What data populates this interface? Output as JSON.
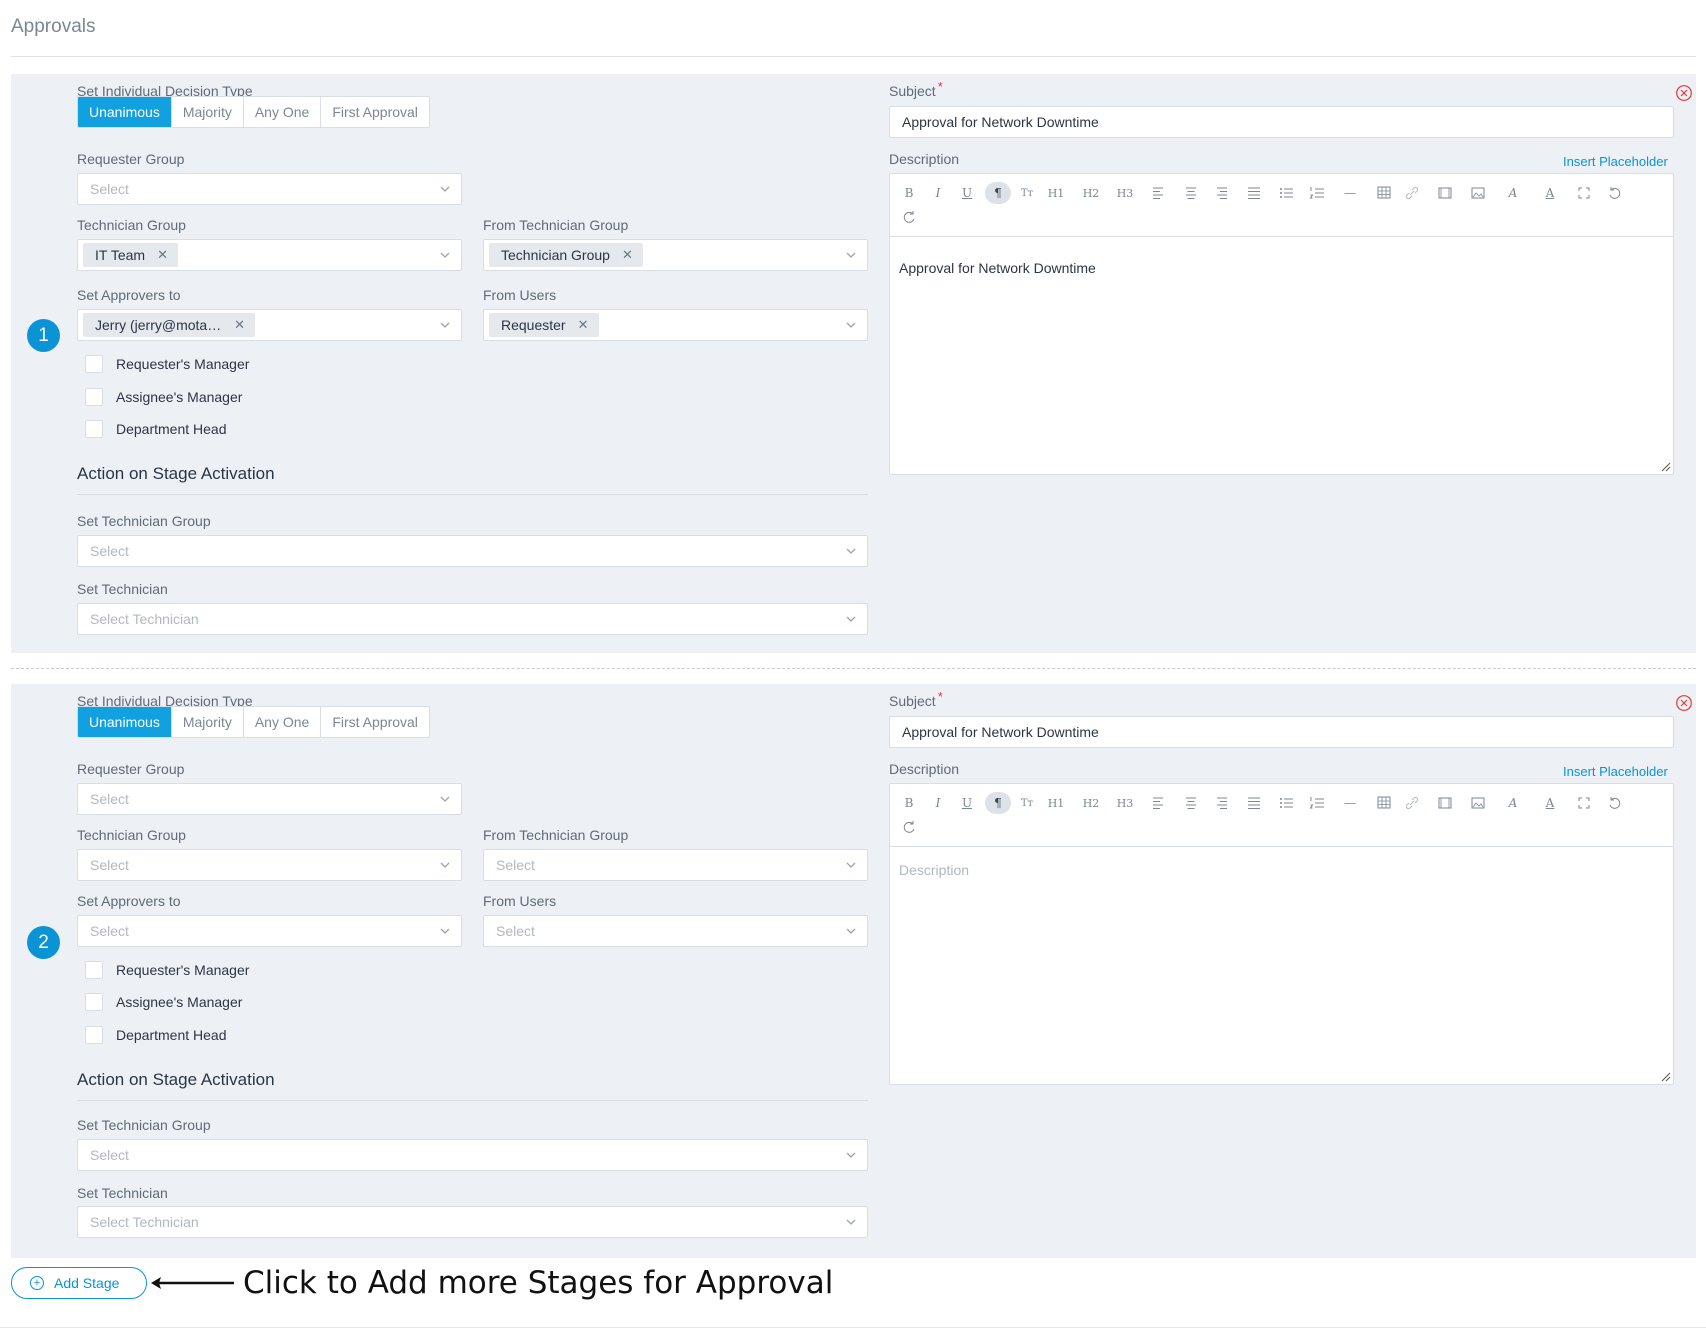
{
  "page": {
    "title": "Approvals"
  },
  "labels": {
    "decision_type": "Set Individual Decision Type",
    "requester_group": "Requester Group",
    "technician_group": "Technician Group",
    "from_technician_group": "From Technician Group",
    "set_approvers_to": "Set Approvers to",
    "from_users": "From Users",
    "action_on_stage_activation": "Action on Stage Activation",
    "set_technician_group": "Set Technician Group",
    "set_technician": "Set Technician",
    "subject": "Subject",
    "required_mark": "*",
    "description": "Description",
    "insert_placeholder": "Insert Placeholder"
  },
  "decision_options": [
    "Unanimous",
    "Majority",
    "Any One",
    "First Approval"
  ],
  "checkbox_labels": [
    "Requester's Manager",
    "Assignee's Manager",
    "Department Head"
  ],
  "placeholders": {
    "select": "Select",
    "select_technician": "Select Technician",
    "description": "Description"
  },
  "toolbar": {
    "bold": "B",
    "italic": "I",
    "underline": "U",
    "paragraph": "¶",
    "text_format": "Tт",
    "h1": "H1",
    "h2": "H2",
    "h3": "H3",
    "hr": "—",
    "font": "A",
    "text_color": "A"
  },
  "stages": [
    {
      "number": "1",
      "decision_type": "Unanimous",
      "technician_group_tag": "IT Team",
      "from_technician_group_tag": "Technician Group",
      "approvers_tag": "Jerry (jerry@motadata.com)",
      "from_users_tag": "Requester",
      "subject": "Approval for Network Downtime",
      "description": "Approval for Network Downtime"
    },
    {
      "number": "2",
      "decision_type": "Unanimous",
      "subject": "Approval for Network Downtime",
      "description": ""
    }
  ],
  "add_stage": {
    "label": "Add Stage",
    "icon": "plus-circle-icon"
  },
  "annotation": {
    "text": "Click to Add more Stages for Approval",
    "icon": "arrow-left-icon"
  },
  "colors": {
    "accent": "#0a94d6",
    "active_segment": "#12a1e0",
    "panel_bg": "#edf0f4",
    "required": "#e53935"
  }
}
